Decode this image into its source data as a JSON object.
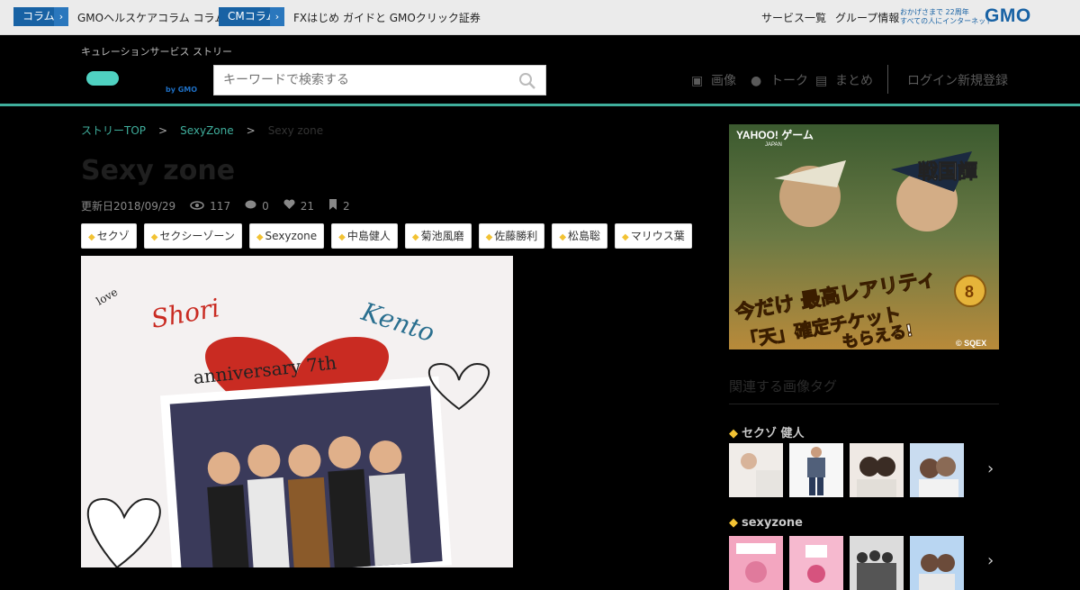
{
  "gmo_bar": {
    "tag1": "コラム",
    "text1": "GMOヘルスケアコラム コラム",
    "tag2": "CMコラム",
    "text2": "FXはじめ ガイドと GMOクリック証券",
    "link1": "サービス一覧",
    "link2": "グループ情報",
    "logo_line1": "おかげさまで 22周年",
    "logo_line2": "すべての人にインターネット",
    "logo": "GMO"
  },
  "header": {
    "tagline": "キュレーションサービス ストリー",
    "logo_sub": "by GMO",
    "search_placeholder": "キーワードで検索する",
    "nav": [
      "画像",
      "トーク",
      "まとめ",
      "ログイン",
      "新規登録"
    ]
  },
  "breadcrumb": [
    "ストリーTOP",
    "SexyZone",
    "Sexy zone"
  ],
  "article": {
    "title": "Sexy zone",
    "date": "更新日2018/09/29",
    "views": "117",
    "comments": "0",
    "likes": "21",
    "clips": "2",
    "tags": [
      "セクゾ",
      "セクシーゾーン",
      "Sexyzone",
      "中島健人",
      "菊池風磨",
      "佐藤勝利",
      "松島聡",
      "マリウス葉"
    ],
    "image_texts": [
      "anniversary 7th",
      "Shori",
      "Kento",
      "love"
    ]
  },
  "ad": {
    "brand": "YAHOO! ゲーム",
    "brand_sub": "JAPAN",
    "game_title": "戦国譚",
    "headline1": "今だけ 最高レアリティ",
    "headline2": "「天」確定チケット",
    "headline3": "もらえる!",
    "copyright": "© SQEX",
    "badge": "8"
  },
  "sidebar": {
    "heading": "関連する画像タグ",
    "groups": [
      {
        "title": "セクゾ 健人"
      },
      {
        "title": "sexyzone"
      }
    ]
  },
  "colors": {
    "accent": "#3fae9c",
    "gmo_blue": "#1862a4",
    "tag_icon": "#f2c233"
  }
}
